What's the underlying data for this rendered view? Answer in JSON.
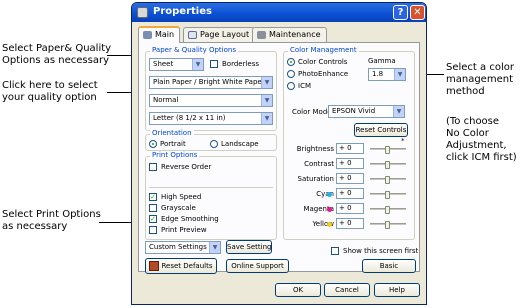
{
  "callouts": {
    "paper_quality": "Select Paper& Quality\nOptions as necessary",
    "quality_option": "Click here to select\nyour quality option",
    "color_method": "Select a color\nmanagement\nmethod",
    "no_color_adj": "(To choose\nNo Color\nAdjustment,\nclick ICM first)",
    "print_options": "Select Print Options\nas necessary"
  },
  "window": {
    "title": "Properties",
    "help_label": "?",
    "close_label": "✕"
  },
  "tabs": [
    {
      "label": "Main",
      "active": true,
      "icon": "main-tab-icon"
    },
    {
      "label": "Page Layout",
      "active": false,
      "icon": "page-layout-tab-icon"
    },
    {
      "label": "Maintenance",
      "active": false,
      "icon": "maintenance-tab-icon"
    }
  ],
  "paper_quality": {
    "title": "Paper & Quality Options",
    "source": "Sheet",
    "borderless_label": "Borderless",
    "borderless_checked": false,
    "paper_type": "Plain Paper / Bright White Paper",
    "quality": "Normal",
    "paper_size": "Letter (8 1/2 x 11 in)"
  },
  "orientation": {
    "title": "Orientation",
    "portrait_label": "Portrait",
    "landscape_label": "Landscape",
    "selected": "portrait"
  },
  "print_options": {
    "title": "Print Options",
    "reverse_order": "Reverse Order",
    "high_speed": "High Speed",
    "grayscale": "Grayscale",
    "edge_smoothing": "Edge Smoothing",
    "print_preview": "Print Preview"
  },
  "color_management": {
    "title": "Color Management",
    "color_controls_label": "Color Controls",
    "photoenhance_label": "PhotoEnhance",
    "icm_label": "ICM",
    "selected": "color_controls",
    "gamma_label": "Gamma",
    "gamma_value": "1.8",
    "color_mode_label": "Color Mode",
    "color_mode_value": "EPSON Vivid",
    "reset_controls_label": "Reset Controls",
    "slider_marker": "*",
    "adjustments": [
      {
        "name": "Brightness",
        "value": "+ 0",
        "color": "",
        "level": 0.5
      },
      {
        "name": "Contrast",
        "value": "+ 0",
        "color": "",
        "level": 0.5
      },
      {
        "name": "Saturation",
        "value": "+ 0",
        "color": "",
        "level": 0.5
      },
      {
        "name": "Cyan",
        "value": "+ 0",
        "color": "#1fb2e8",
        "level": 0.5
      },
      {
        "name": "Magenta",
        "value": "+ 0",
        "color": "#e21c8c",
        "level": 0.5
      },
      {
        "name": "Yellow",
        "value": "+ 0",
        "color": "#f2cc14",
        "level": 0.5
      }
    ]
  },
  "bottom": {
    "custom_settings": "Custom Settings",
    "save_setting": "Save Setting",
    "reset_defaults": "Reset Defaults",
    "online_support": "Online Support",
    "show_first_label": "Show this screen first",
    "basic": "Basic"
  },
  "footer": {
    "ok": "OK",
    "cancel": "Cancel",
    "help": "Help"
  },
  "accent": {
    "checkbox": "#21a121",
    "group_title": "#0046d5",
    "titlebar": "#0a4fd4"
  }
}
